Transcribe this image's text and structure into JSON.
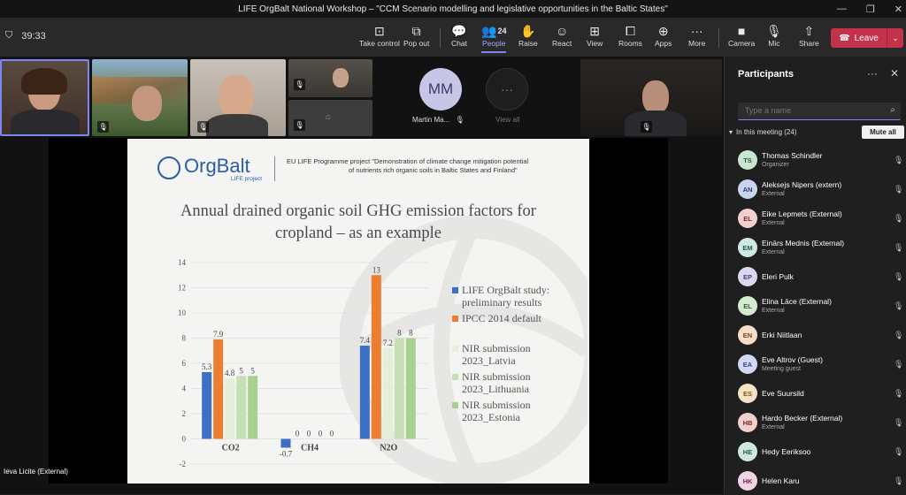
{
  "window": {
    "title": "LIFE OrgBalt National Workshop – \"CCM Scenario modelling and legislative opportunities in the Baltic States\"",
    "controls": [
      "—",
      "❐",
      "✕"
    ]
  },
  "toolbar": {
    "timer": "39:33",
    "buttons": [
      {
        "id": "take-control",
        "label": "Take control",
        "icon": "⊡"
      },
      {
        "id": "pop-out",
        "label": "Pop out",
        "icon": "⧉"
      },
      {
        "id": "chat",
        "label": "Chat",
        "icon": "💬"
      },
      {
        "id": "people",
        "label": "People",
        "icon": "👥",
        "count": "24"
      },
      {
        "id": "raise",
        "label": "Raise",
        "icon": "✋"
      },
      {
        "id": "react",
        "label": "React",
        "icon": "☺"
      },
      {
        "id": "view",
        "label": "View",
        "icon": "⊞"
      },
      {
        "id": "rooms",
        "label": "Rooms",
        "icon": "⧠"
      },
      {
        "id": "apps",
        "label": "Apps",
        "icon": "⊕"
      },
      {
        "id": "more",
        "label": "More",
        "icon": "···"
      },
      {
        "id": "camera",
        "label": "Camera",
        "icon": "■"
      },
      {
        "id": "mic",
        "label": "Mic",
        "icon": "🎙"
      },
      {
        "id": "share",
        "label": "Share",
        "icon": "⇧"
      }
    ],
    "leave_label": "Leave"
  },
  "stage": {
    "mm_initials": "MM",
    "mm_name": "Martin Ma...",
    "view_all": "View all",
    "presenter_name": "Ieva Licite (External)"
  },
  "slide": {
    "logo_text": "OrgBalt",
    "logo_sub": "LIFE project",
    "project_text_1": "EU LIFE Programme project \"Demonstration of climate change mitigation potential",
    "project_text_2": "of nutrients rich organic soils in Baltic States and Finland\"",
    "title_1": "Annual drained organic soil GHG emission factors for",
    "title_2": "cropland – as an example"
  },
  "chart_data": {
    "type": "bar",
    "categories": [
      "CO2",
      "CH4",
      "N2O"
    ],
    "ylim": [
      -2,
      14
    ],
    "yticks": [
      -2,
      0,
      2,
      4,
      6,
      8,
      10,
      12,
      14
    ],
    "series": [
      {
        "name": "LIFE OrgBalt study: preliminary results",
        "color": "#3d6fc4",
        "values": [
          5.3,
          -0.7,
          7.4
        ]
      },
      {
        "name": "IPCC 2014 default",
        "color": "#ed7d31",
        "values": [
          7.9,
          0,
          13
        ]
      },
      {
        "name": "NIR submission 2023_Latvia",
        "color": "#e2efd9",
        "values": [
          4.8,
          0,
          7.2
        ]
      },
      {
        "name": "NIR submission 2023_Lithuania",
        "color": "#c5e0b4",
        "values": [
          5,
          0,
          8
        ]
      },
      {
        "name": "NIR submission 2023_Estonia",
        "color": "#a9d18e",
        "values": [
          5,
          0,
          8
        ]
      }
    ],
    "legend_lines": [
      [
        "LIFE OrgBalt study:",
        "preliminary results"
      ],
      [
        "IPCC 2014 default"
      ],
      [
        "NIR submission",
        "2023_Latvia"
      ],
      [
        "NIR submission",
        "2023_Lithuania"
      ],
      [
        "NIR submission",
        "2023_Estonia"
      ]
    ]
  },
  "panel": {
    "title": "Participants",
    "more_icon": "···",
    "close_icon": "✕",
    "search_placeholder": "Type a name",
    "in_meeting": "In this meeting (24)",
    "mute_all": "Mute all",
    "participants": [
      {
        "initials": "TS",
        "name": "Thomas Schindler",
        "role": "Organizer",
        "bg": "#c8e6d2",
        "fg": "#2a5a3a"
      },
      {
        "initials": "AN",
        "name": "Aleksejs Nipers (extern)",
        "role": "External",
        "bg": "#c8d4ee",
        "fg": "#2d3f6b"
      },
      {
        "initials": "EL",
        "name": "Eike Lepmets (External)",
        "role": "External",
        "bg": "#f3d0d0",
        "fg": "#7a2b2b"
      },
      {
        "initials": "EM",
        "name": "Einārs Mednis (External)",
        "role": "External",
        "bg": "#cce9e4",
        "fg": "#275a52"
      },
      {
        "initials": "EP",
        "name": "Eleri Pulk",
        "role": "",
        "bg": "#ddd6f0",
        "fg": "#4a3d78"
      },
      {
        "initials": "EL",
        "name": "Elina Lāce (External)",
        "role": "External",
        "bg": "#d5ebd0",
        "fg": "#355c2e"
      },
      {
        "initials": "EN",
        "name": "Erki Niitlaan",
        "role": "",
        "bg": "#f7dcc8",
        "fg": "#7a4320"
      },
      {
        "initials": "EA",
        "name": "Eve Altrov (Guest)",
        "role": "Meeting guest",
        "bg": "#d3d8f2",
        "fg": "#3a427a"
      },
      {
        "initials": "ES",
        "name": "Eve Suursild",
        "role": "",
        "bg": "#f6e3c4",
        "fg": "#7a5a1d"
      },
      {
        "initials": "HB",
        "name": "Hardo Becker (External)",
        "role": "External",
        "bg": "#f3d0d0",
        "fg": "#7a2b2b"
      },
      {
        "initials": "HE",
        "name": "Hedy Eeriksoo",
        "role": "",
        "bg": "#cfe8de",
        "fg": "#2b5a48"
      },
      {
        "initials": "HK",
        "name": "Helen Karu",
        "role": "",
        "bg": "#f0d4e4",
        "fg": "#6e2f52"
      }
    ]
  }
}
